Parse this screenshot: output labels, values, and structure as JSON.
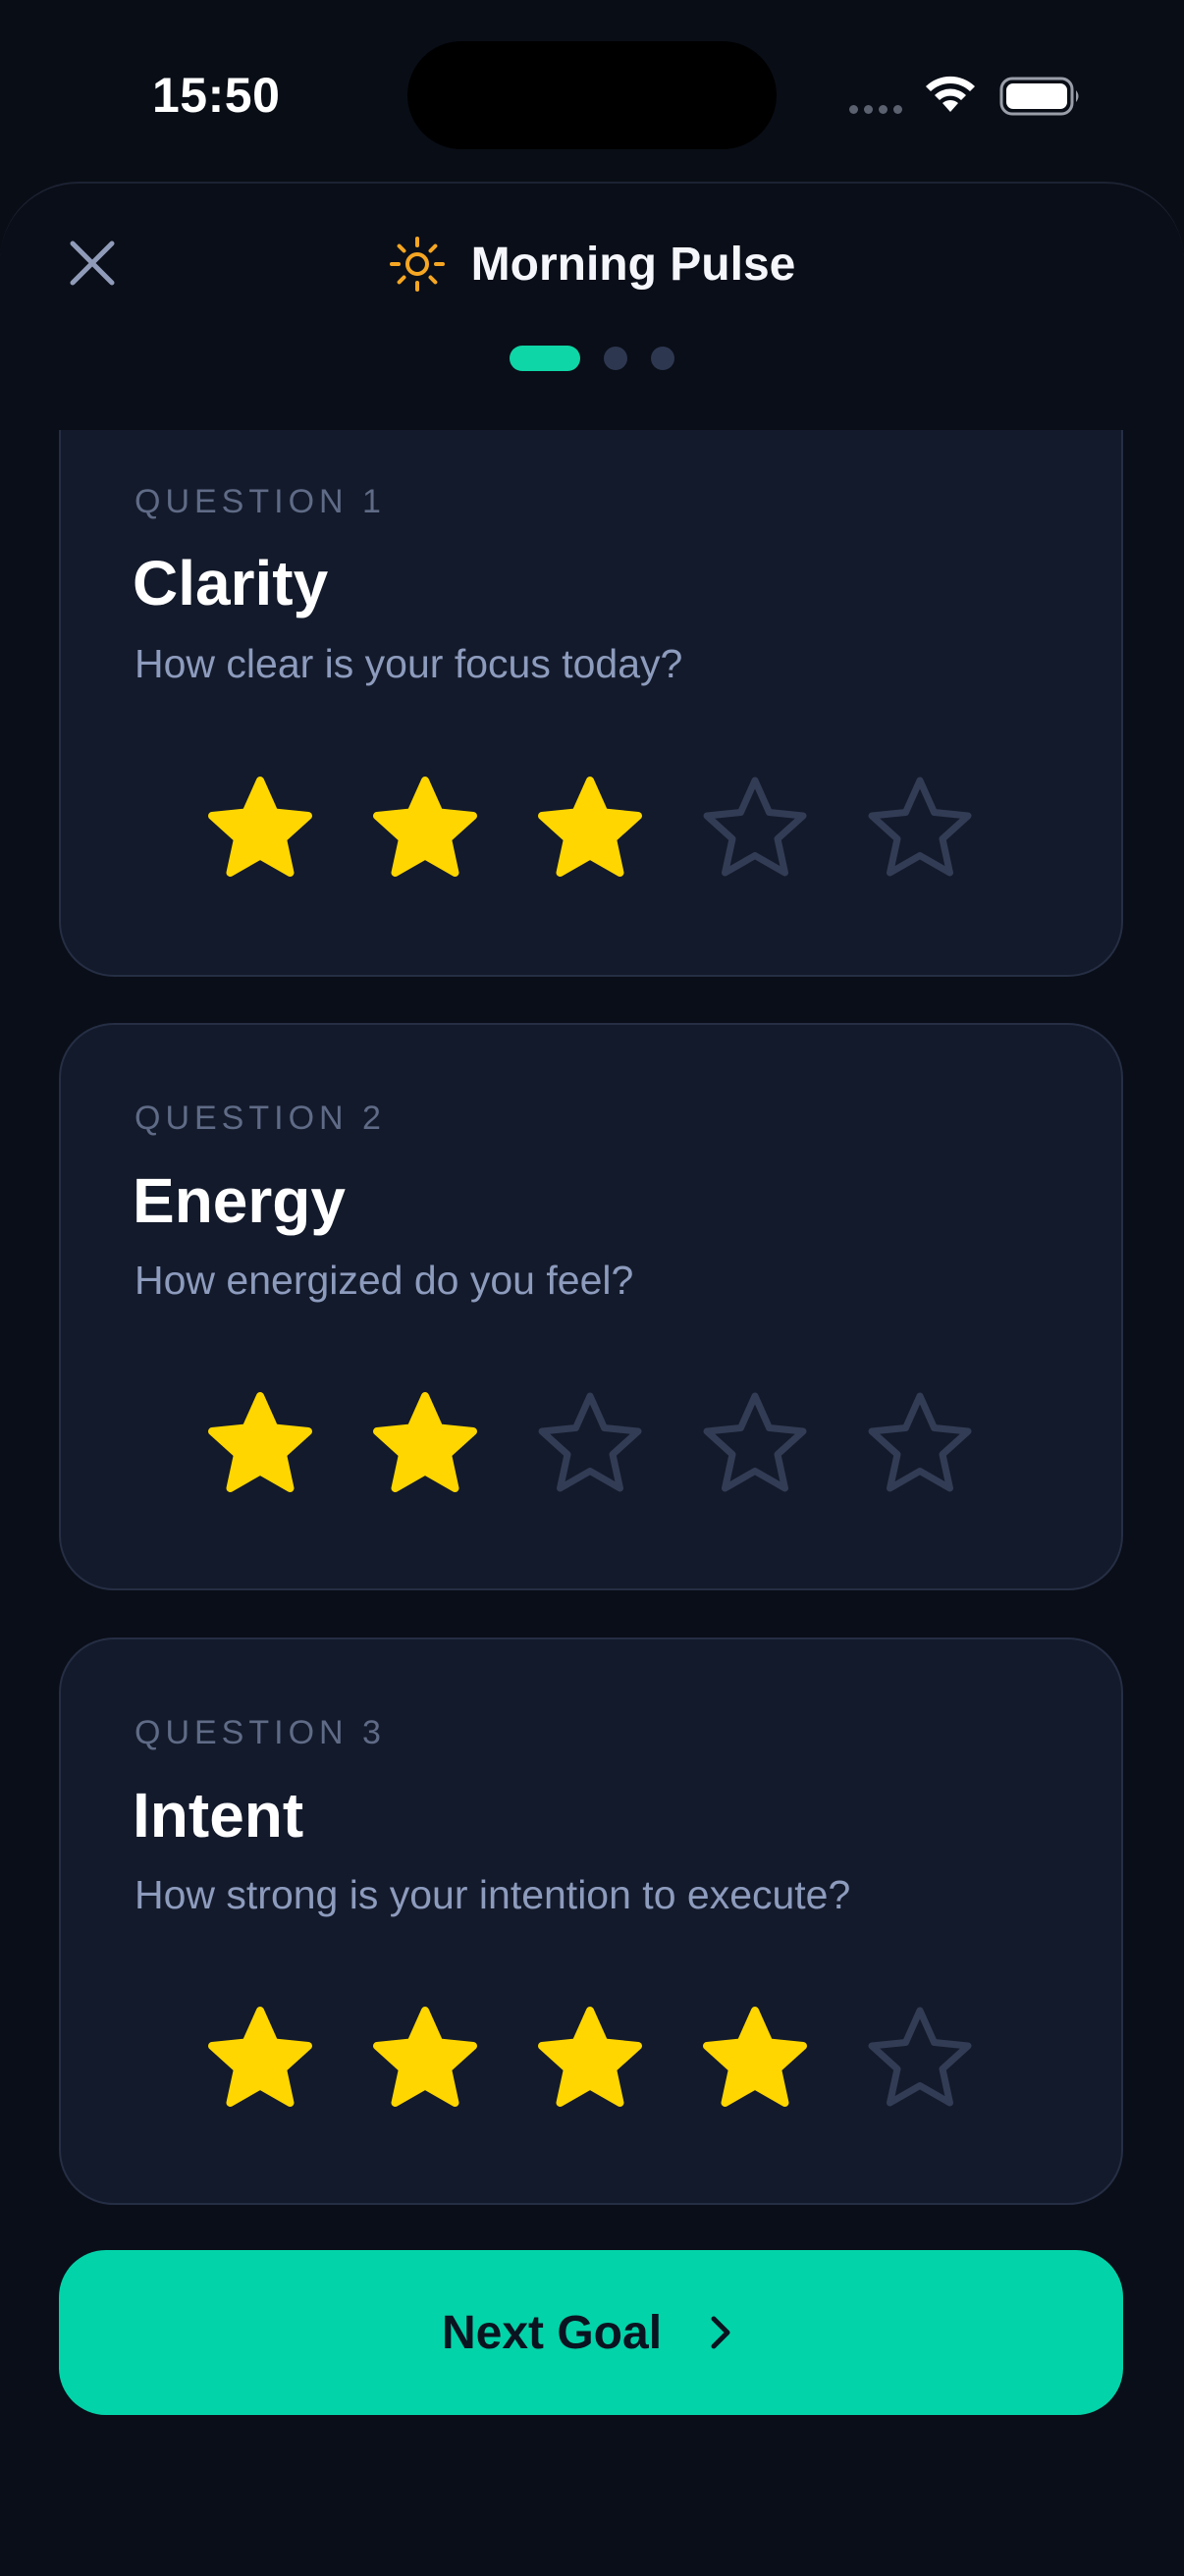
{
  "status_bar": {
    "time": "15:50"
  },
  "header": {
    "title": "Morning Pulse",
    "steps": 3,
    "current_step": 1
  },
  "questions": [
    {
      "label": "QUESTION 1",
      "title": "Clarity",
      "description": "How clear is your focus today?",
      "rating": 3,
      "max": 5
    },
    {
      "label": "QUESTION 2",
      "title": "Energy",
      "description": "How energized do you feel?",
      "rating": 2,
      "max": 5
    },
    {
      "label": "QUESTION 3",
      "title": "Intent",
      "description": "How strong is your intention to execute?",
      "rating": 4,
      "max": 5
    }
  ],
  "footer": {
    "next_label": "Next Goal"
  },
  "colors": {
    "accent": "#03d3a9",
    "star_filled": "#ffd600",
    "star_empty": "#323c55"
  },
  "icons": [
    "close-icon",
    "sun-icon",
    "star-icon",
    "chevron-right-icon",
    "wifi-icon",
    "battery-icon"
  ]
}
